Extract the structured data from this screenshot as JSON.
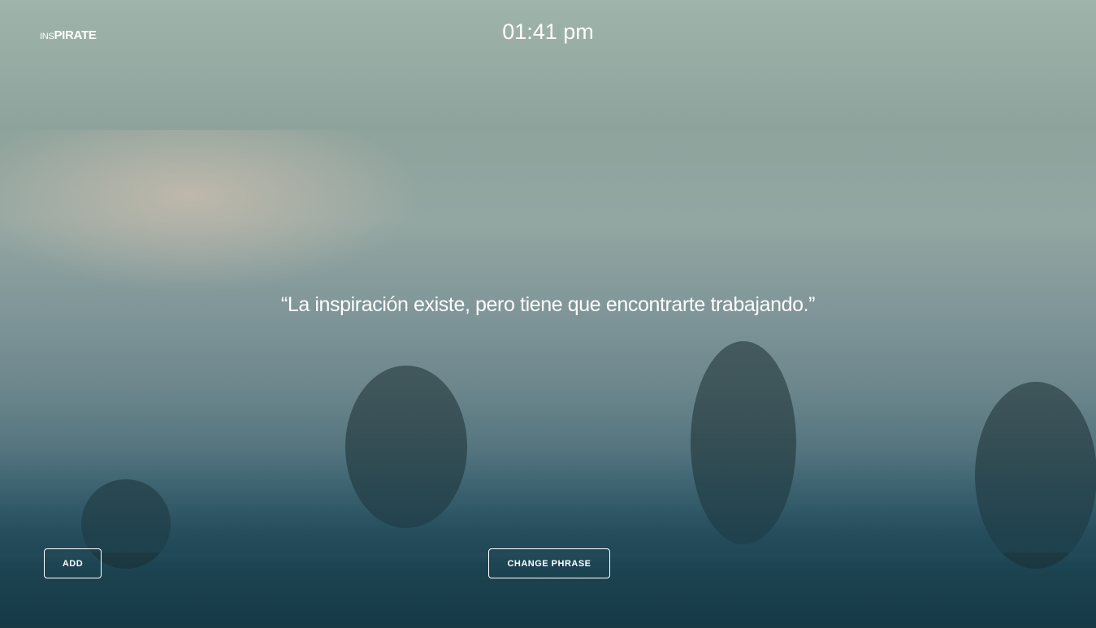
{
  "logo": {
    "prefix": "INS",
    "main": "PIRATE"
  },
  "clock": {
    "time": "01:41 pm"
  },
  "quote": {
    "text": "“La inspiración existe, pero tiene que encontrarte trabajando.”"
  },
  "buttons": {
    "add": "ADD",
    "change_phrase": "CHANGE PHRASE"
  }
}
